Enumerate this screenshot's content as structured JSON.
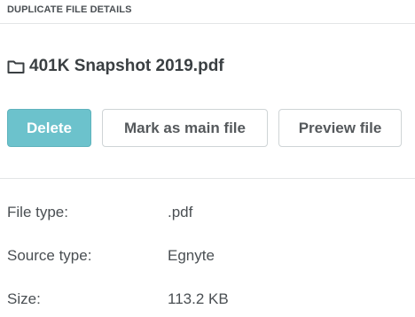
{
  "header": {
    "title": "DUPLICATE FILE DETAILS"
  },
  "file": {
    "icon": "folder-icon",
    "name": "401K Snapshot 2019.pdf"
  },
  "actions": {
    "delete_label": "Delete",
    "mark_main_label": "Mark as main file",
    "preview_label": "Preview file"
  },
  "details": [
    {
      "label": "File type:",
      "value": ".pdf"
    },
    {
      "label": "Source type:",
      "value": "Egnyte"
    },
    {
      "label": "Size:",
      "value": "113.2 KB"
    }
  ],
  "colors": {
    "accent": "#6cc2cc",
    "text": "#4a4f53",
    "border": "#cfd4d6"
  }
}
